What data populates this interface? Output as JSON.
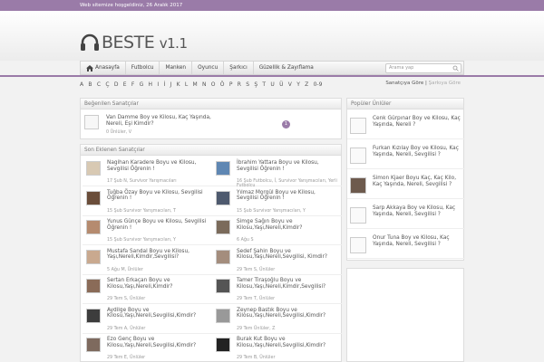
{
  "topbar": {
    "welcome": "Web sitemize hoşgeldiniz, 26 Aralık 2017"
  },
  "logo": {
    "name": "BESTE",
    "version": "v1.1",
    "icon": "headphones-icon"
  },
  "nav": {
    "items": [
      {
        "label": "Anasayfa",
        "icon": "home-icon"
      },
      {
        "label": "Futbolcu"
      },
      {
        "label": "Manken"
      },
      {
        "label": "Oyuncu"
      },
      {
        "label": "Şarkıcı"
      },
      {
        "label": "Güzellik & Zayıflama"
      }
    ],
    "search_placeholder": "Arama yap"
  },
  "alphabet": [
    "A",
    "B",
    "C",
    "Ç",
    "D",
    "E",
    "F",
    "G",
    "H",
    "I",
    "İ",
    "J",
    "K",
    "L",
    "M",
    "N",
    "O",
    "Ö",
    "P",
    "R",
    "S",
    "Ş",
    "T",
    "U",
    "Ü",
    "V",
    "Y",
    "Z",
    "0-9"
  ],
  "sort": {
    "active": "Sanatçıya Göre",
    "separator": "|",
    "inactive": "Şarkıya Göre"
  },
  "liked": {
    "title": "Beğenilen Sanatçılar",
    "item": {
      "name": "Van Damme Boy ve Kilosu, Kaç Yaşında, Nereli, Eşi Kimdir?",
      "meta": "0  Ünlüler, V",
      "badge": "1"
    }
  },
  "recent": {
    "title": "Son Eklenen Sanatçılar",
    "left": [
      {
        "name": "Nagihan Karadere Boyu ve Kilosu, Sevgilisi Öğrenin !",
        "meta": "17 Şub  N, Survivor Yarışmacıları"
      },
      {
        "name": "Tuğba Özay Boyu ve Kilosu, Sevgilisi Öğrenin !",
        "meta": "15 Şub  Survivor Yarışmacıları, T"
      },
      {
        "name": "Yunus Günçe Boyu ve Kilosu, Sevgilisi Öğrenin !",
        "meta": "15 Şub  Survivor Yarışmacıları, Y"
      },
      {
        "name": "Mustafa Sandal Boyu ve Kilosu, Yaşı,Nereli,Kimdir,Sevgilisi?",
        "meta": "5 Ağu  M, Ünlüler"
      },
      {
        "name": "Sertan Erkaçan Boyu ve Kilosu,Yaşı,Nereli,Kimdir?",
        "meta": "29 Tem  S, Ünlüler"
      },
      {
        "name": "Aydilge Boyu ve Kilosu,Yaşı,Nereli,Sevgilisi,Kimdir?",
        "meta": "29 Tem  A, Ünlüler"
      },
      {
        "name": "Ezo Genç Boyu ve Kilosu,Yaşı,Nereli,Sevgilisi,Kimdir?",
        "meta": "29 Tem  E, Ünlüler"
      }
    ],
    "right": [
      {
        "name": "İbrahim Yattara Boyu ve Kilosu, Sevgilisi Öğrenin !",
        "meta": "16 Şub  Futbolcu, İ, Survivor Yarışmacıları, Yerli Futbolcu"
      },
      {
        "name": "Yılmaz Morgül Boyu ve Kilosu, Sevgilisi Öğrenin !",
        "meta": "15 Şub  Survivor Yarışmacıları, Y"
      },
      {
        "name": "Simge Sağın Boyu ve Kilosu,Yaşı,Nereli,Kimdir?",
        "meta": "6 Ağu  S"
      },
      {
        "name": "Sedef Şahin Boyu ve Kilosu,Yaşı,Nereli,Sevgilisi, Kimdir?",
        "meta": "29 Tem  S, Ünlüler"
      },
      {
        "name": "Tamer Tiraşoğlu Boyu ve Kilosu,Yaşı,Nereli,Kimdir,Sevgilisi?",
        "meta": "29 Tem  T, Ünlüler"
      },
      {
        "name": "Zeynep Bastık Boyu ve Kilosu,Yaşı,Nereli,Sevgilisi,Kimdir?",
        "meta": "29 Tem  Ünlüler, Z"
      },
      {
        "name": "Burak Kut Boyu ve Kilosu,Yaşı,Nereli,Sevgilisi,Kimdir?",
        "meta": "29 Tem  B, Ünlüler"
      }
    ]
  },
  "popular": {
    "title": "Popüler Ünlüler",
    "items": [
      {
        "name": "Cenk Gürpınar Boy ve Kilosu, Kaç Yaşında, Nereli ?"
      },
      {
        "name": "Furkan Kızılay Boy ve Kilosu, Kaç Yaşında, Nereli, Sevgilisi ?"
      },
      {
        "name": "Simon Kjaer Boyu Kaç, Kaç Kilo, Kaç Yaşında, Nereli, Sevgilisi ?"
      },
      {
        "name": "Sarp Akkaya Boy ve Kilosu, Kaç Yaşında, Nereli, Sevgilisi ?"
      },
      {
        "name": "Onur Tuna Boy ve Kilosu, Kaç Yaşında, Nereli, Sevgilisi ?"
      }
    ]
  },
  "colors": {
    "accent": "#9a7ba8"
  }
}
